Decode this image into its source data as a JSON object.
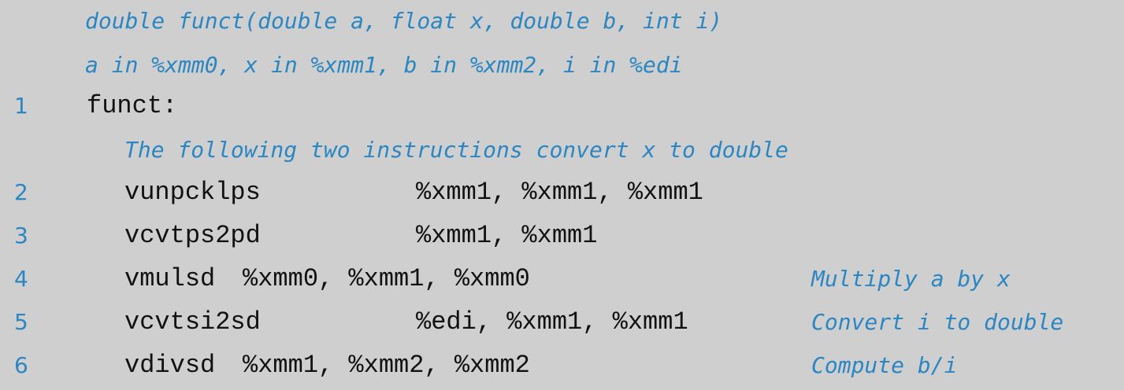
{
  "header_comments": [
    "double funct(double a, float x, double b, int i)",
    "a in %xmm0, x in %xmm1, b in %xmm2, i in %edi"
  ],
  "lines": [
    {
      "num": "1",
      "label": "funct:"
    },
    {
      "comment": "The following two instructions convert x to double"
    },
    {
      "num": "2",
      "instr": "vunpcklps",
      "operands": "%xmm1, %xmm1, %xmm1",
      "note": ""
    },
    {
      "num": "3",
      "instr": "vcvtps2pd",
      "operands": "%xmm1, %xmm1",
      "note": ""
    },
    {
      "num": "4",
      "instr": "vmulsd",
      "operands": "%xmm0, %xmm1, %xmm0",
      "note": "Multiply a by x"
    },
    {
      "num": "5",
      "instr": "vcvtsi2sd",
      "operands": "%edi, %xmm1, %xmm1",
      "note": "Convert i to double"
    },
    {
      "num": "6",
      "instr": "vdivsd",
      "operands": "%xmm1, %xmm2, %xmm2",
      "note": "Compute b/i"
    }
  ],
  "colors": {
    "background": "#cfcfcf",
    "comment": "#2b86c2",
    "code": "#111111"
  }
}
